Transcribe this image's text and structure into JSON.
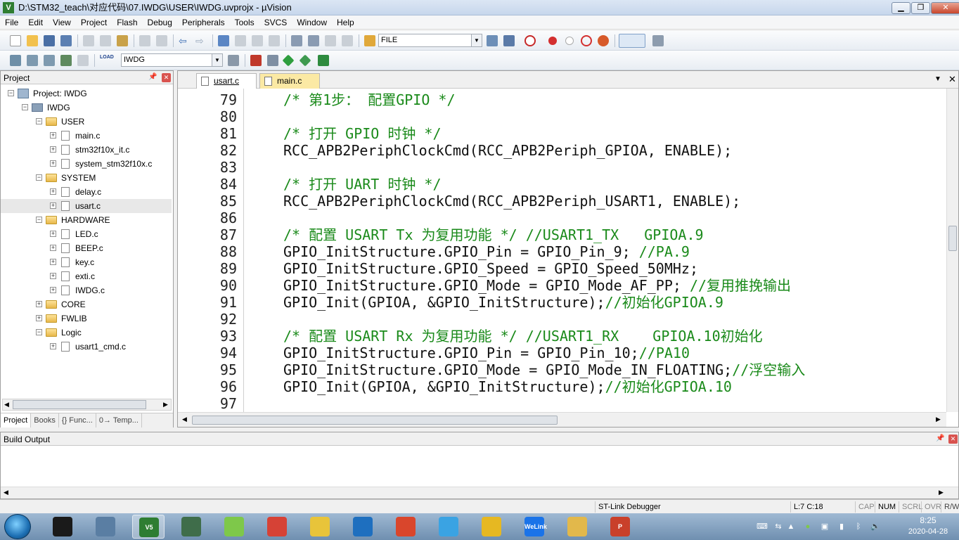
{
  "window": {
    "title": "D:\\STM32_teach\\对应代码\\07.IWDG\\USER\\IWDG.uvprojx - µVision",
    "app_icon": "V"
  },
  "menu": [
    "File",
    "Edit",
    "View",
    "Project",
    "Flash",
    "Debug",
    "Peripherals",
    "Tools",
    "SVCS",
    "Window",
    "Help"
  ],
  "toolbar": {
    "find_combo": "FILE",
    "target_combo": "IWDG",
    "load_label": "LOAD"
  },
  "project_panel": {
    "title": "Project",
    "tabs": [
      "Project",
      "Books",
      "{} Func...",
      "0→ Temp..."
    ],
    "tree": {
      "root": "Project: IWDG",
      "target": "IWDG",
      "groups": [
        {
          "name": "USER",
          "files": [
            "main.c",
            "stm32f10x_it.c",
            "system_stm32f10x.c"
          ]
        },
        {
          "name": "SYSTEM",
          "files": [
            "delay.c",
            "usart.c"
          ]
        },
        {
          "name": "HARDWARE",
          "files": [
            "LED.c",
            "BEEP.c",
            "key.c",
            "exti.c",
            "IWDG.c"
          ]
        },
        {
          "name": "CORE",
          "files": []
        },
        {
          "name": "FWLIB",
          "files": []
        },
        {
          "name": "Logic",
          "files": [
            "usart1_cmd.c"
          ]
        }
      ]
    }
  },
  "editor": {
    "tabs": [
      {
        "label": "usart.c",
        "active": true
      },
      {
        "label": "main.c",
        "active": false
      }
    ],
    "lines": [
      {
        "num": "79",
        "code": "/* 第1步： 配置GPIO */",
        "comment": true
      },
      {
        "num": "80",
        "code": "",
        "comment": false
      },
      {
        "num": "81",
        "code": "/* 打开 GPIO 时钟 */",
        "comment": true
      },
      {
        "num": "82",
        "code": "RCC_APB2PeriphClockCmd(RCC_APB2Periph_GPIOA, ENABLE);",
        "comment": false
      },
      {
        "num": "83",
        "code": "",
        "comment": false
      },
      {
        "num": "84",
        "code": "/* 打开 UART 时钟 */",
        "comment": true
      },
      {
        "num": "85",
        "code": "RCC_APB2PeriphClockCmd(RCC_APB2Periph_USART1, ENABLE);",
        "comment": false
      },
      {
        "num": "86",
        "code": "",
        "comment": false
      },
      {
        "num": "87",
        "code": "/* 配置 USART Tx 为复用功能 */ //USART1_TX   GPIOA.9",
        "comment": true
      },
      {
        "num": "88",
        "code": "GPIO_InitStructure.GPIO_Pin = GPIO_Pin_9;",
        "tail": " //PA.9",
        "comment": false
      },
      {
        "num": "89",
        "code": "GPIO_InitStructure.GPIO_Speed = GPIO_Speed_50MHz;",
        "comment": false
      },
      {
        "num": "90",
        "code": "GPIO_InitStructure.GPIO_Mode = GPIO_Mode_AF_PP;",
        "tail": " //复用推挽输出",
        "comment": false
      },
      {
        "num": "91",
        "code": "GPIO_Init(GPIOA, &GPIO_InitStructure);",
        "tail": "//初始化GPIOA.9",
        "comment": false
      },
      {
        "num": "92",
        "code": "",
        "comment": false
      },
      {
        "num": "93",
        "code": "/* 配置 USART Rx 为复用功能 */ //USART1_RX    GPIOA.10初始化",
        "comment": true
      },
      {
        "num": "94",
        "code": "GPIO_InitStructure.GPIO_Pin = GPIO_Pin_10;",
        "tail": "//PA10",
        "comment": false
      },
      {
        "num": "95",
        "code": "GPIO_InitStructure.GPIO_Mode = GPIO_Mode_IN_FLOATING;",
        "tail": "//浮空输入",
        "comment": false
      },
      {
        "num": "96",
        "code": "GPIO_Init(GPIOA, &GPIO_InitStructure);",
        "tail": "//初始化GPIOA.10",
        "comment": false
      },
      {
        "num": "97",
        "code": "",
        "comment": false
      }
    ]
  },
  "build_output": {
    "title": "Build Output"
  },
  "status": {
    "debugger": "ST-Link Debugger",
    "position": "L:7 C:18",
    "caps": "CAP",
    "num": "NUM",
    "scrl": "SCRL",
    "ovr": "OVR",
    "rw": "R/W"
  },
  "taskbar": {
    "time": "8:25",
    "date": "2020-04-28",
    "apps": [
      {
        "name": "qq",
        "color": "#1a1a1a",
        "label": ""
      },
      {
        "name": "network",
        "color": "#5a7ea3",
        "label": ""
      },
      {
        "name": "keil",
        "color": "#2e7d32",
        "label": "V5"
      },
      {
        "name": "stm-tool",
        "color": "#3f6d4a",
        "label": ""
      },
      {
        "name": "wechat",
        "color": "#7ec84a",
        "label": ""
      },
      {
        "name": "chrome",
        "color": "#d64236",
        "label": ""
      },
      {
        "name": "app-chart",
        "color": "#e8c43a",
        "label": ""
      },
      {
        "name": "app-m",
        "color": "#1e6fbf",
        "label": ""
      },
      {
        "name": "app-map",
        "color": "#d9462c",
        "label": ""
      },
      {
        "name": "app-flower",
        "color": "#3aa3e3",
        "label": ""
      },
      {
        "name": "app-note",
        "color": "#e6b822",
        "label": ""
      },
      {
        "name": "welink",
        "color": "#1a73e8",
        "label": "WeLink"
      },
      {
        "name": "explorer",
        "color": "#e2b84b",
        "label": ""
      },
      {
        "name": "powerpoint",
        "color": "#c9402a",
        "label": "P"
      }
    ]
  }
}
